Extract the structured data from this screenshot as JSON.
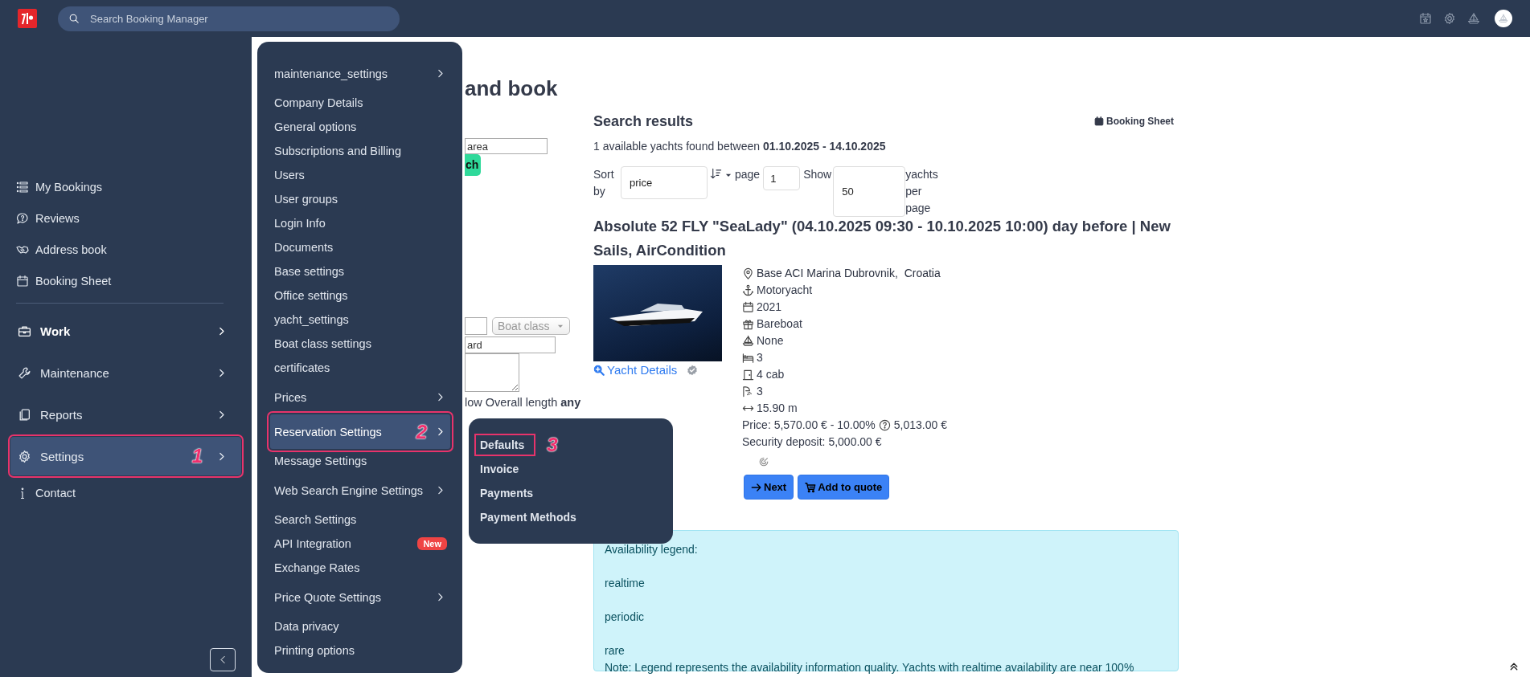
{
  "top_bar": {
    "search": {
      "placeholder": "Search Booking Manager"
    }
  },
  "sidebar": {
    "items": [
      {
        "label": "My Bookings",
        "kind": "link",
        "active": false,
        "selected": false
      },
      {
        "label": "Reviews",
        "kind": "link",
        "active": false,
        "selected": false
      },
      {
        "label": "Address book",
        "kind": "link",
        "active": false,
        "selected": false
      },
      {
        "label": "Booking Sheet",
        "kind": "link",
        "active": false,
        "selected": false
      },
      {
        "label": "Work",
        "kind": "section",
        "active": true,
        "selected": false
      },
      {
        "label": "Maintenance",
        "kind": "section",
        "active": false,
        "selected": false
      },
      {
        "label": "Reports",
        "kind": "section",
        "active": false,
        "selected": false
      },
      {
        "label": "Settings",
        "kind": "section",
        "active": false,
        "selected": true,
        "callout": "1"
      },
      {
        "label": "Contact",
        "kind": "link",
        "active": false,
        "selected": false
      }
    ]
  },
  "settings_menu": {
    "items": [
      {
        "label": "maintenance_settings",
        "kind": "submenu",
        "selected": false
      },
      {
        "label": "Company Details",
        "kind": "link",
        "selected": false
      },
      {
        "label": "General options",
        "kind": "link",
        "selected": false
      },
      {
        "label": "Subscriptions and Billing",
        "kind": "link",
        "selected": false
      },
      {
        "label": "Users",
        "kind": "link",
        "selected": false
      },
      {
        "label": "User groups",
        "kind": "link",
        "selected": false
      },
      {
        "label": "Login Info",
        "kind": "link",
        "selected": false
      },
      {
        "label": "Documents",
        "kind": "link",
        "selected": false
      },
      {
        "label": "Base settings",
        "kind": "link",
        "selected": false
      },
      {
        "label": "Office settings",
        "kind": "link",
        "selected": false
      },
      {
        "label": "yacht_settings",
        "kind": "link",
        "selected": false
      },
      {
        "label": "Boat class settings",
        "kind": "link",
        "selected": false
      },
      {
        "label": "certificates",
        "kind": "link",
        "selected": false
      },
      {
        "label": "Prices",
        "kind": "submenu",
        "selected": false
      },
      {
        "label": "Reservation Settings",
        "kind": "submenu",
        "selected": true,
        "callout": "2"
      },
      {
        "label": "Message Settings",
        "kind": "link",
        "selected": false
      },
      {
        "label": "Web Search Engine Settings",
        "kind": "submenu",
        "selected": false
      },
      {
        "label": "Search Settings",
        "kind": "link",
        "selected": false
      },
      {
        "label": "API Integration",
        "kind": "link",
        "selected": false,
        "badge": "New"
      },
      {
        "label": "Exchange Rates",
        "kind": "link",
        "selected": false
      },
      {
        "label": "Price Quote Settings",
        "kind": "submenu",
        "selected": false
      },
      {
        "label": "Data privacy",
        "kind": "link",
        "selected": false
      },
      {
        "label": "Printing options",
        "kind": "link",
        "selected": false
      }
    ]
  },
  "submenu": {
    "items": [
      {
        "label": "Defaults",
        "callout": "3"
      },
      {
        "label": "Invoice"
      },
      {
        "label": "Payments"
      },
      {
        "label": "Payment Methods"
      }
    ]
  },
  "search_form": {
    "title": "and book",
    "area_field": {
      "value": "area"
    },
    "search_button": "ch",
    "boat_class_select": "Boat class",
    "field_2": {
      "value": "ard"
    },
    "filter_text": "low Overall length **any**"
  },
  "results": {
    "title": "Search results",
    "booking_sheet_link": "Booking Sheet",
    "summary": "1 available yachts found between **01.10.2025 - 14.10.2025**",
    "sort_label": "Sort by",
    "sort_select": "price",
    "page_label": "page",
    "page_field": "1",
    "show_label": "Show",
    "per_page_field": "50",
    "per_page_suffix": "yachts per page",
    "yacht": {
      "title": "Absolute 52 FLY \"SeaLady\" (04.10.2025 09:30 - 10.10.2025 10:00) day before | New Sails, AirCondition",
      "details_link": "Yacht Details",
      "specs": [
        "Base ACI Marina Dubrovnik,  Croatia",
        "Motoryacht",
        "2021",
        "Bareboat",
        "None",
        "3",
        "4 cab",
        "3",
        "15.90 m"
      ],
      "price": "Price: 5,570.00 € - 10.00%",
      "price_final": "5,013.00 €",
      "deposit": "Security deposit: 5,000.00 €",
      "buttons": [
        {
          "label": "Next",
          "kind": "next"
        },
        {
          "label": "Add to quote",
          "kind": "quote"
        }
      ]
    },
    "legend": {
      "title": "Availability legend:",
      "levels": [
        "realtime",
        "periodic",
        "rare"
      ],
      "note": "Note: Legend represents the availability information quality. Yachts with realtime availability are near 100%"
    }
  }
}
